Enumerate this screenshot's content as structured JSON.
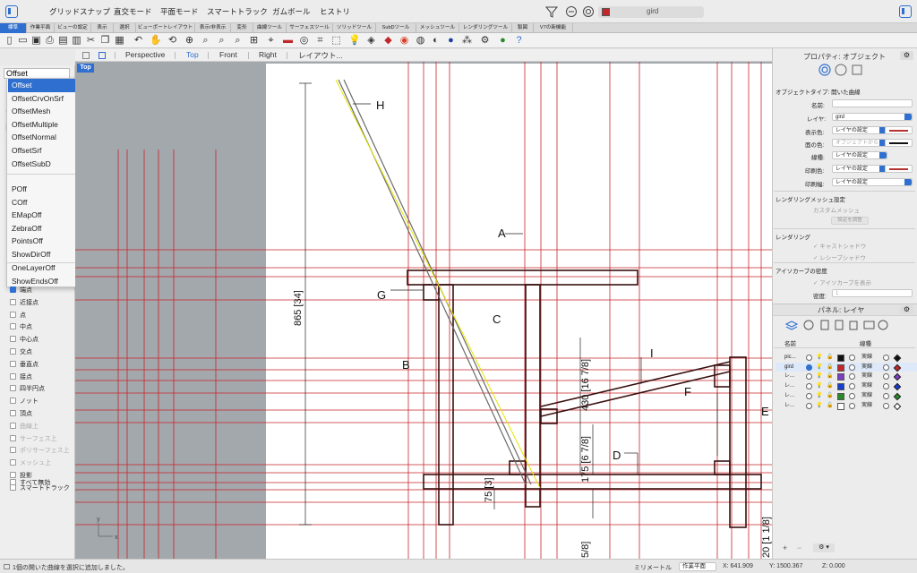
{
  "modebar": {
    "modes": [
      "グリッドスナップ",
      "直交モード",
      "平面モード",
      "スマートトラック",
      "ガムボール",
      "ヒストリ"
    ],
    "current_layer": "gird",
    "layer_color": "#c0282a"
  },
  "tabs": [
    "標準",
    "作業平面",
    "ビューの設定",
    "表示",
    "選択",
    "ビューポートレイアウト",
    "表示/非表示",
    "変形",
    "曲線ツール",
    "サーフェスツール",
    "ソリッドツール",
    "SubDツール",
    "メッシュツール",
    "レンダリングツール",
    "製図",
    "V7の新機能"
  ],
  "toolbar_icons": [
    "new-icon",
    "open-icon",
    "save-icon",
    "print-icon",
    "import-icon",
    "cut-icon",
    "copy-icon",
    "paste-icon",
    "undo-icon",
    "pan-icon",
    "rotate-view-icon",
    "zoom-icon",
    "zoom-window-icon",
    "zoom-extents-icon",
    "zoom-selected-icon",
    "four-view-icon",
    "camera-icon",
    "car-icon",
    "named-view-icon",
    "construction-plane-icon",
    "select-icon",
    "point-icon",
    "light-icon",
    "layer-icon",
    "properties-icon",
    "color-icon",
    "render-icon",
    "shaded-icon",
    "rendered-icon",
    "sphere-icon",
    "snapshot-icon",
    "options-icon",
    "globe-icon",
    "help-icon"
  ],
  "viewport_tabs": [
    "Perspective",
    "Top",
    "Front",
    "Right",
    "レイアウト..."
  ],
  "active_viewport": "Top",
  "command": {
    "value": "Offset",
    "suggestions_group1": [
      "Offset",
      "OffsetCrvOnSrf",
      "OffsetMesh",
      "OffsetMultiple",
      "OffsetNormal",
      "OffsetSrf",
      "OffsetSubD"
    ],
    "suggestions_group2": [
      "POff",
      "COff",
      "EMapOff",
      "ZebraOff",
      "PointsOff",
      "ShowDirOff"
    ],
    "suggestions_group3": [
      "OneLayerOff",
      "ShowEndsOff"
    ]
  },
  "osnaps": [
    {
      "label": "端点",
      "checked": true,
      "dim": false
    },
    {
      "label": "近接点",
      "checked": false,
      "dim": false
    },
    {
      "label": "点",
      "checked": false,
      "dim": false
    },
    {
      "label": "中点",
      "checked": false,
      "dim": false
    },
    {
      "label": "中心点",
      "checked": false,
      "dim": false
    },
    {
      "label": "交点",
      "checked": false,
      "dim": false
    },
    {
      "label": "垂直点",
      "checked": false,
      "dim": false
    },
    {
      "label": "接点",
      "checked": false,
      "dim": false
    },
    {
      "label": "四半円点",
      "checked": false,
      "dim": false
    },
    {
      "label": "ノット",
      "checked": false,
      "dim": false
    },
    {
      "label": "頂点",
      "checked": false,
      "dim": false
    },
    {
      "label": "曲線上",
      "checked": false,
      "dim": true
    },
    {
      "label": "サーフェス上",
      "checked": false,
      "dim": true
    },
    {
      "label": "ポリサーフェス上",
      "checked": false,
      "dim": true
    },
    {
      "label": "メッシュ上",
      "checked": false,
      "dim": true
    },
    {
      "label": "投影",
      "checked": false,
      "dim": false
    },
    {
      "label": "スマートトラック",
      "checked": false,
      "dim": false
    }
  ],
  "osnap_disable_all": "すべて無効",
  "viewport": {
    "label": "Top",
    "drawing_labels": [
      "H",
      "A",
      "G",
      "C",
      "B",
      "I",
      "F",
      "E",
      "D"
    ],
    "dimensions": [
      "865 [34]",
      "430 [16 7/8]",
      "175 [6 7/8]",
      "75 [3]",
      "5/8]",
      "20 [1 1/8]"
    ],
    "axis_x": "x",
    "axis_y": "y"
  },
  "properties": {
    "title": "プロパティ: オブジェクト",
    "object_type": "オブジェクトタイプ: 開いた曲線",
    "labels": {
      "name": "名前:",
      "layer": "レイヤ:",
      "display_color": "表示色:",
      "face_color": "面の色:",
      "linetype": "線種:",
      "print_color": "印刷色:",
      "print_width": "印刷幅:"
    },
    "values": {
      "layer": "gird",
      "display_color": "レイヤの設定",
      "face_color": "オブジェクトから",
      "linetype": "レイヤの設定",
      "print_color": "レイヤの設定",
      "print_width": "レイヤの設定"
    },
    "colors": {
      "display": "#b5332f",
      "face": "#111111",
      "print": "#b5332f"
    },
    "render_mesh_heading": "レンダリングメッシュ設定",
    "custom_mesh": "カスタムメッシュ",
    "adjust_settings": "設定を調整",
    "rendering_heading": "レンダリング",
    "cast_shadows": "キャストシャドウ",
    "receive_shadows": "レシーブシャドウ",
    "isocurve_heading": "アイソカーブの密度",
    "show_isocurves": "アイソカーブを表示",
    "density_label": "密度:",
    "density_value": "1"
  },
  "layers_panel": {
    "title": "パネル: レイヤ",
    "col_name": "名前",
    "col_linetype": "線種",
    "rows": [
      {
        "name": "pic...",
        "current": false,
        "color": "#111111",
        "linetype": "実線",
        "pcolor": "#111111"
      },
      {
        "name": "gird",
        "current": true,
        "color": "#c0282a",
        "linetype": "実線",
        "pcolor": "#c0282a"
      },
      {
        "name": "レ...",
        "current": false,
        "color": "#7d3fc2",
        "linetype": "実線",
        "pcolor": "#7d3fc2"
      },
      {
        "name": "レ...",
        "current": false,
        "color": "#1a3fd0",
        "linetype": "実線",
        "pcolor": "#1a3fd0"
      },
      {
        "name": "レ...",
        "current": false,
        "color": "#2a8a2a",
        "linetype": "実線",
        "pcolor": "#2a8a2a"
      },
      {
        "name": "レ...",
        "current": false,
        "color": "#ffffff",
        "linetype": "実線",
        "pcolor": "#ffffff"
      }
    ]
  },
  "status": {
    "message": "1個の開いた曲線を選択に追加しました。",
    "units": "ミリメートル",
    "cplane": "作業平面",
    "x": "X: 641.909",
    "y": "Y: 1500.367",
    "z": "Z: 0.000"
  }
}
